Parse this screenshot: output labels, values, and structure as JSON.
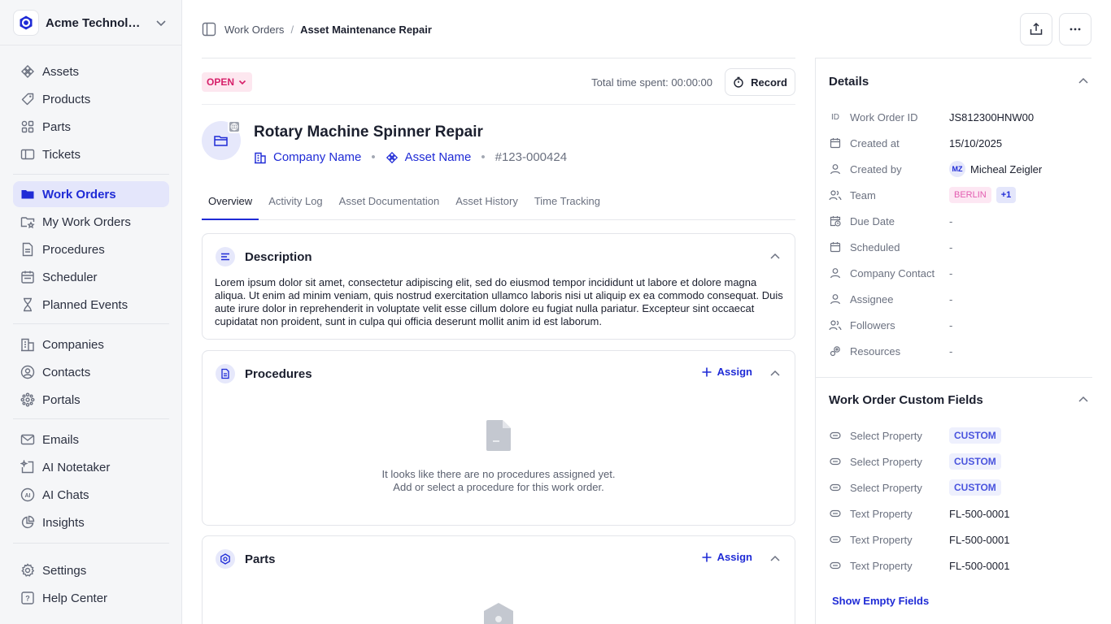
{
  "org": {
    "name": "Acme Technologies"
  },
  "nav": {
    "group1": [
      {
        "label": "Assets",
        "icon": "assets-icon"
      },
      {
        "label": "Products",
        "icon": "products-icon"
      },
      {
        "label": "Parts",
        "icon": "parts-icon"
      },
      {
        "label": "Tickets",
        "icon": "tickets-icon"
      }
    ],
    "group2": [
      {
        "label": "Work Orders",
        "icon": "work-orders-icon",
        "active": true
      },
      {
        "label": "My Work Orders",
        "icon": "my-work-orders-icon"
      },
      {
        "label": "Procedures",
        "icon": "procedures-icon"
      },
      {
        "label": "Scheduler",
        "icon": "calendar-icon"
      },
      {
        "label": "Planned Events",
        "icon": "hourglass-icon"
      }
    ],
    "group3": [
      {
        "label": "Companies",
        "icon": "building-icon"
      },
      {
        "label": "Contacts",
        "icon": "contact-icon"
      },
      {
        "label": "Portals",
        "icon": "portals-icon"
      }
    ],
    "group4": [
      {
        "label": "Emails",
        "icon": "mail-icon"
      },
      {
        "label": "AI Notetaker",
        "icon": "ai-notetaker-icon"
      },
      {
        "label": "AI Chats",
        "icon": "ai-chats-icon"
      },
      {
        "label": "Insights",
        "icon": "insights-icon"
      }
    ],
    "group5": [
      {
        "label": "Settings",
        "icon": "gear-icon"
      },
      {
        "label": "Help Center",
        "icon": "help-icon"
      }
    ]
  },
  "breadcrumb": {
    "parent": "Work Orders",
    "separator": "/",
    "current": "Asset Maintenance Repair"
  },
  "status": {
    "label": "OPEN",
    "time_label": "Total time spent: 00:00:00",
    "record_label": "Record"
  },
  "work_order": {
    "title": "Rotary Machine Spinner Repair",
    "company": "Company Name",
    "asset": "Asset Name",
    "number": "#123-000424",
    "dot": "•"
  },
  "tabs": [
    "Overview",
    "Activity Log",
    "Asset Documentation",
    "Asset History",
    "Time Tracking"
  ],
  "description": {
    "title": "Description",
    "text": "Lorem ipsum dolor sit amet, consectetur adipiscing elit, sed do eiusmod tempor incididunt ut labore et dolore magna aliqua. Ut enim ad minim veniam, quis nostrud exercitation ullamco laboris nisi ut aliquip ex ea commodo consequat. Duis aute irure dolor in reprehenderit in voluptate velit esse cillum dolore eu fugiat nulla pariatur. Excepteur sint occaecat cupidatat non proident, sunt in culpa qui officia deserunt mollit anim id est laborum."
  },
  "procedures": {
    "title": "Procedures",
    "assign_label": "Assign",
    "empty_line1": "It looks like there are no procedures assigned yet.",
    "empty_line2": "Add or select a procedure for this work order."
  },
  "parts": {
    "title": "Parts",
    "assign_label": "Assign"
  },
  "details": {
    "title": "Details",
    "id_icon_text": "ID",
    "work_order_id_label": "Work Order ID",
    "work_order_id": "JS812300HNW00",
    "created_at_label": "Created at",
    "created_at": "15/10/2025",
    "created_by_label": "Created by",
    "created_by_initials": "MZ",
    "created_by": "Micheal Zeigler",
    "team_label": "Team",
    "team": "BERLIN",
    "team_more": "+1",
    "due_date_label": "Due Date",
    "due_date": "-",
    "scheduled_label": "Scheduled",
    "scheduled": "-",
    "company_contact_label": "Company Contact",
    "company_contact": "-",
    "assignee_label": "Assignee",
    "assignee": "-",
    "followers_label": "Followers",
    "followers": "-",
    "resources_label": "Resources",
    "resources": "-"
  },
  "custom_fields": {
    "title": "Work Order Custom Fields",
    "rows": [
      {
        "label": "Select Property",
        "value": "CUSTOM"
      },
      {
        "label": "Select Property",
        "value": "CUSTOM"
      },
      {
        "label": "Select Property",
        "value": "CUSTOM"
      },
      {
        "label": "Text Property",
        "value": "FL-500-0001"
      },
      {
        "label": "Text Property",
        "value": "FL-500-0001"
      },
      {
        "label": "Text Property",
        "value": "FL-500-0001"
      }
    ],
    "show_empty_label": "Show Empty Fields"
  },
  "colors": {
    "accent": "#1f2bd6",
    "open_status": "#d61f69",
    "berlin_tag": "#e25cb0"
  }
}
